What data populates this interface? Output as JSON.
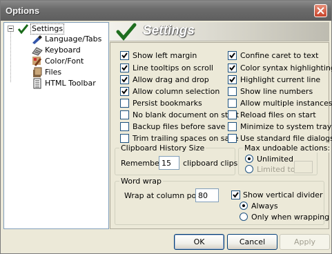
{
  "window": {
    "title": "Options"
  },
  "tree": {
    "items": [
      {
        "label": "Settings",
        "icon": "check-icon",
        "selected": true
      },
      {
        "label": "Language/Tabs",
        "icon": "language-tabs-icon"
      },
      {
        "label": "Keyboard",
        "icon": "keyboard-icon"
      },
      {
        "label": "Color/Font",
        "icon": "color-font-icon"
      },
      {
        "label": "Files",
        "icon": "files-icon"
      },
      {
        "label": "HTML Toolbar",
        "icon": "html-toolbar-icon"
      }
    ]
  },
  "header": {
    "title": "Settings"
  },
  "checkboxes_left": [
    {
      "label": "Show left margin",
      "checked": true
    },
    {
      "label": "Line tooltips on scroll",
      "checked": true
    },
    {
      "label": "Allow drag and drop",
      "checked": true
    },
    {
      "label": "Allow column selection",
      "checked": true
    },
    {
      "label": "Persist bookmarks",
      "checked": false
    },
    {
      "label": "No blank document on start",
      "checked": false
    },
    {
      "label": "Backup files before save",
      "checked": false
    },
    {
      "label": "Trim trailing spaces on save",
      "checked": false
    }
  ],
  "checkboxes_right": [
    {
      "label": "Confine caret to text",
      "checked": true
    },
    {
      "label": "Color syntax highlighting",
      "checked": true
    },
    {
      "label": "Highlight current line",
      "checked": true
    },
    {
      "label": "Show line numbers",
      "checked": false
    },
    {
      "label": "Allow multiple instances",
      "checked": false
    },
    {
      "label": "Reload files on start",
      "checked": false
    },
    {
      "label": "Minimize to system tray",
      "checked": false
    },
    {
      "label": "Use standard file dialogs",
      "checked": false
    }
  ],
  "clipboard": {
    "group_title": "Clipboard History Size",
    "remember_label": "Remember",
    "value": "15",
    "suffix": "clipboard clips"
  },
  "undo": {
    "group_title": "Max undoable actions:",
    "unlimited_label": "Unlimited",
    "limited_label": "Limited to:",
    "selected": "Unlimited",
    "limited_value": ""
  },
  "wordwrap": {
    "group_title": "Word wrap",
    "wrap_label": "Wrap at column pos:",
    "wrap_value": "80",
    "divider_label": "Show vertical divider",
    "divider_checked": true,
    "always_label": "Always",
    "only_label": "Only  when wrapping",
    "selected": "Always"
  },
  "buttons": {
    "ok": "OK",
    "cancel": "Cancel",
    "apply": "Apply"
  }
}
